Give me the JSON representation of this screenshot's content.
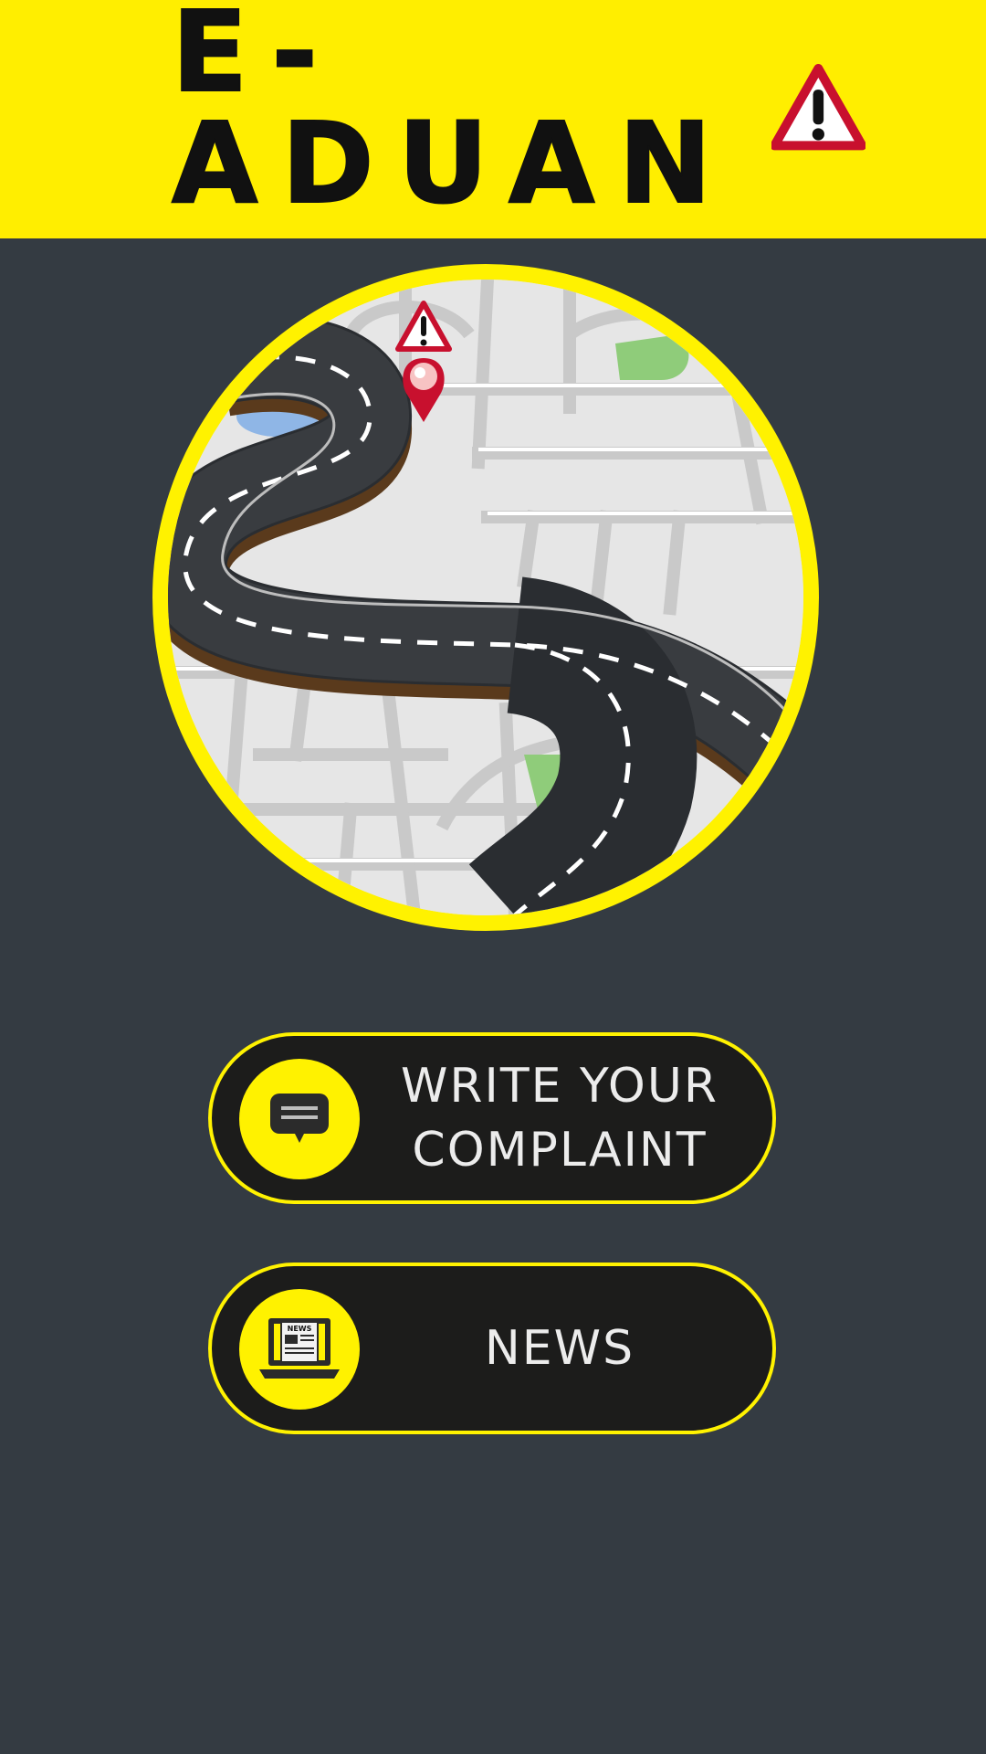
{
  "header": {
    "logo_text": "E-ADUAN",
    "logo_icon": "warning-triangle-icon",
    "background_color": "#ffee00"
  },
  "hero": {
    "image": "winding-road-map-illustration",
    "icons": [
      "warning-triangle-icon",
      "map-pin-icon"
    ]
  },
  "buttons": {
    "complaint": {
      "icon": "chat-message-icon",
      "line1": "WRITE YOUR",
      "line2": "COMPLAINT"
    },
    "news": {
      "icon": "newspaper-laptop-icon",
      "label": "NEWS",
      "icon_text": "NEWS"
    }
  },
  "colors": {
    "accent": "#fff200",
    "background": "#343b42",
    "button_fill": "#1c1c1b"
  }
}
